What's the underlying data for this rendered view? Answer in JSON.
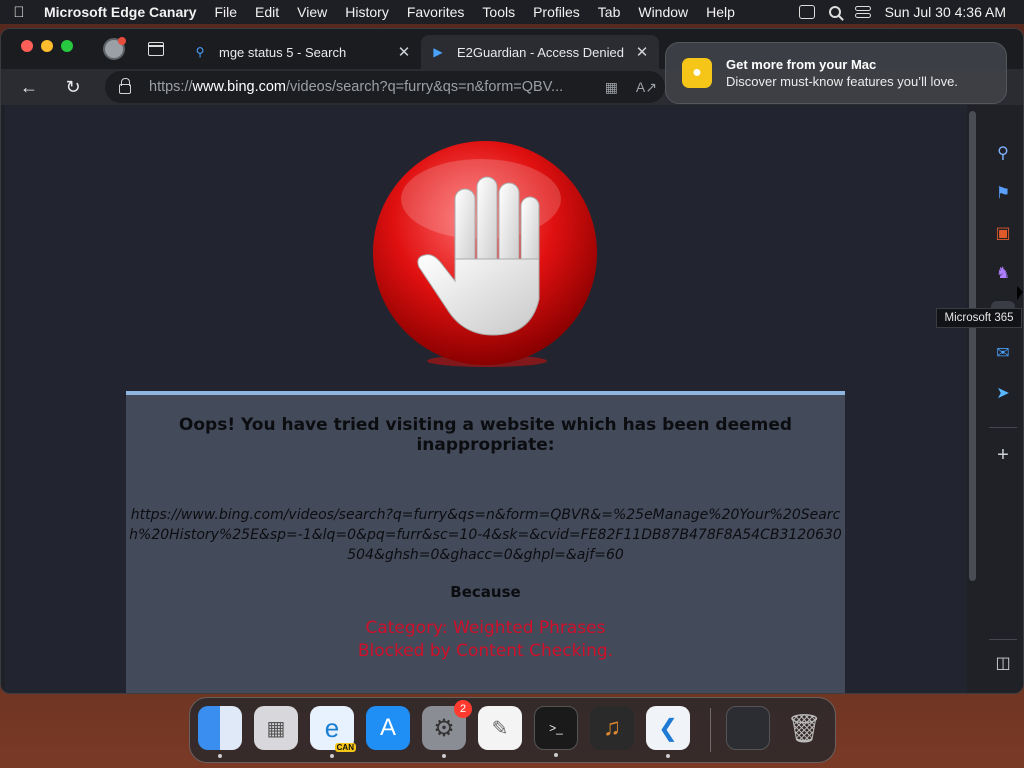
{
  "menubar": {
    "apple_icon": "apple-icon",
    "app_name": "Microsoft Edge Canary",
    "menus": [
      "File",
      "Edit",
      "View",
      "History",
      "Favorites",
      "Tools",
      "Profiles",
      "Tab",
      "Window",
      "Help"
    ],
    "datetime": "Sun Jul 30  4:36 AM"
  },
  "tabs": [
    {
      "title": "mge status 5 - Search",
      "favicon": "search-icon"
    },
    {
      "title": "E2Guardian - Access Denied",
      "favicon": "bing-icon"
    }
  ],
  "toolbar": {
    "url_prefix": "https://",
    "url_host": "www.bing.com",
    "url_rest": "/videos/search?q=furry&qs=n&form=QBV..."
  },
  "notification": {
    "title": "Get more from your Mac",
    "body": "Discover must-know features you’ll love."
  },
  "tooltip": "Microsoft 365",
  "page": {
    "headline": "Oops! You have tried visiting a website which has been deemed inappropriate:",
    "blocked_url": "https://www.bing.com/videos/search?q=furry&qs=n&form=QBVR&=%25eManage%20Your%20Search%20History%25E&sp=-1&lq=0&pq=furr&sc=10-4&sk=&cvid=FE82F11DB87B478F8A54CB3120630504&ghsh=0&ghacc=0&ghpl=&ajf=60",
    "because": "Because",
    "reason_line1": "Category: Weighted Phrases",
    "reason_line2": "Blocked by Content Checking."
  },
  "colors": {
    "reason_red": "#d0102a",
    "panel_bg": "#434a5a",
    "content_bg": "#22252f"
  },
  "dock": {
    "apps": [
      "finder-icon",
      "launchpad-icon",
      "edge-canary-icon",
      "app-store-icon",
      "system-settings-icon",
      "textedit-icon",
      "terminal-icon",
      "garageband-icon",
      "vscode-icon",
      "window-thumbnail-icon",
      "trash-icon"
    ],
    "settings_badge": "2",
    "edge_label": "CAN"
  }
}
